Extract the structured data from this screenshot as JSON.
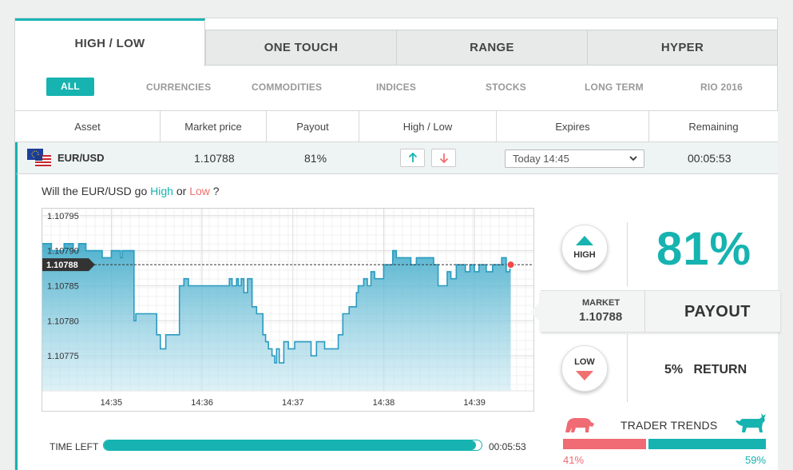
{
  "tabs": [
    {
      "label": "HIGH / LOW",
      "active": true
    },
    {
      "label": "ONE TOUCH",
      "active": false
    },
    {
      "label": "RANGE",
      "active": false
    },
    {
      "label": "HYPER",
      "active": false
    }
  ],
  "filters": [
    "ALL",
    "CURRENCIES",
    "COMMODITIES",
    "INDICES",
    "STOCKS",
    "LONG TERM",
    "RIO 2016"
  ],
  "columns": [
    "Asset",
    "Market price",
    "Payout",
    "High / Low",
    "Expires",
    "Remaining"
  ],
  "row": {
    "asset": "EUR/USD",
    "market_price": "1.10788",
    "payout": "81%",
    "expires": "Today 14:45",
    "remaining": "00:05:53"
  },
  "question": {
    "prefix": "Will the EUR/USD go ",
    "high": "High",
    "middle": " or ",
    "low": "Low",
    "suffix": " ?"
  },
  "chart_data": {
    "type": "area",
    "y_tick_labels": [
      "1.10795",
      "1.10790",
      "1.10785",
      "1.10780",
      "1.10775"
    ],
    "y_ticks": [
      1.10795,
      1.1079,
      1.10785,
      1.1078,
      1.10775
    ],
    "ylim": [
      1.1077,
      1.10796
    ],
    "x_tick_labels": [
      "14:35",
      "14:36",
      "14:37",
      "14:38",
      "14:39"
    ],
    "x_ticks_min": [
      0,
      1,
      2,
      3,
      4
    ],
    "xlim_min": [
      -0.76,
      4.65
    ],
    "current_value_label": "1.10788",
    "current_value": 1.10788,
    "grid": true,
    "series": [
      {
        "x_min": [
          -0.76,
          -0.66,
          -0.66,
          -0.52,
          -0.52,
          -0.42,
          -0.42,
          -0.36,
          -0.36,
          -0.28,
          -0.28,
          -0.18,
          -0.18,
          -0.1,
          -0.1,
          0.0,
          0.0,
          0.1,
          0.1,
          0.12,
          0.12,
          0.25,
          0.25,
          0.27,
          0.27,
          0.5,
          0.5,
          0.54,
          0.54,
          0.6,
          0.6,
          0.75,
          0.75,
          0.8,
          0.8,
          0.85,
          0.85,
          1.3,
          1.3,
          1.33,
          1.33,
          1.38,
          1.38,
          1.4,
          1.4,
          1.43,
          1.43,
          1.46,
          1.46,
          1.5,
          1.5,
          1.55,
          1.55,
          1.6,
          1.6,
          1.67,
          1.67,
          1.7,
          1.7,
          1.73,
          1.73,
          1.77,
          1.77,
          1.8,
          1.8,
          1.82,
          1.82,
          1.85,
          1.85,
          1.9,
          1.9,
          1.95,
          1.95,
          2.02,
          2.02,
          2.2,
          2.2,
          2.26,
          2.26,
          2.35,
          2.35,
          2.5,
          2.5,
          2.55,
          2.55,
          2.62,
          2.62,
          2.7,
          2.7,
          2.72,
          2.72,
          2.78,
          2.78,
          2.82,
          2.82,
          2.86,
          2.86,
          2.9,
          2.9,
          3.0,
          3.0,
          3.1,
          3.1,
          3.14,
          3.14,
          3.2,
          3.2,
          3.3,
          3.3,
          3.32,
          3.32,
          3.36,
          3.36,
          3.55,
          3.55,
          3.6,
          3.6,
          3.7,
          3.7,
          3.74,
          3.74,
          3.8,
          3.8,
          3.9,
          3.9,
          3.95,
          3.95,
          4.0,
          4.0,
          4.05,
          4.05,
          4.13,
          4.13,
          4.2,
          4.2,
          4.3,
          4.3,
          4.35,
          4.35,
          4.39,
          4.39,
          4.4
        ],
        "y": [
          1.10791,
          1.10791,
          1.1079,
          1.1079,
          1.10791,
          1.10791,
          1.1079,
          1.1079,
          1.10791,
          1.10791,
          1.1079,
          1.1079,
          1.1079,
          1.1079,
          1.10789,
          1.10789,
          1.1079,
          1.1079,
          1.10789,
          1.10789,
          1.1079,
          1.1079,
          1.1078,
          1.1078,
          1.10781,
          1.10781,
          1.10778,
          1.10778,
          1.10776,
          1.10776,
          1.10778,
          1.10778,
          1.10785,
          1.10785,
          1.10786,
          1.10786,
          1.10785,
          1.10785,
          1.10786,
          1.10786,
          1.10785,
          1.10785,
          1.10786,
          1.10786,
          1.10785,
          1.10785,
          1.10786,
          1.10786,
          1.10784,
          1.10784,
          1.10786,
          1.10786,
          1.10782,
          1.10782,
          1.10781,
          1.10781,
          1.10778,
          1.10778,
          1.10777,
          1.10777,
          1.10776,
          1.10776,
          1.10775,
          1.10775,
          1.10774,
          1.10774,
          1.10776,
          1.10776,
          1.10774,
          1.10774,
          1.10777,
          1.10777,
          1.10776,
          1.10776,
          1.10777,
          1.10777,
          1.10775,
          1.10775,
          1.10777,
          1.10777,
          1.10776,
          1.10776,
          1.10778,
          1.10778,
          1.10781,
          1.10781,
          1.10782,
          1.10782,
          1.10784,
          1.10784,
          1.10785,
          1.10785,
          1.10786,
          1.10786,
          1.10785,
          1.10785,
          1.10787,
          1.10787,
          1.10786,
          1.10786,
          1.10788,
          1.10788,
          1.1079,
          1.1079,
          1.10789,
          1.10789,
          1.10789,
          1.10789,
          1.10788,
          1.10788,
          1.10788,
          1.10788,
          1.10789,
          1.10789,
          1.10788,
          1.10788,
          1.10785,
          1.10785,
          1.10787,
          1.10787,
          1.10786,
          1.10786,
          1.10788,
          1.10788,
          1.10787,
          1.10787,
          1.10788,
          1.10788,
          1.10787,
          1.10787,
          1.10788,
          1.10788,
          1.10787,
          1.10787,
          1.10788,
          1.10788,
          1.10789,
          1.10789,
          1.10787,
          1.10787,
          1.10788,
          1.10788
        ]
      }
    ]
  },
  "trade": {
    "high_label": "HIGH",
    "low_label": "LOW",
    "payout_pct": "81%",
    "market_label": "MARKET",
    "market_value": "1.10788",
    "payout_label": "PAYOUT",
    "return_pct": "5%",
    "return_label": "RETURN"
  },
  "time_left": {
    "label": "TIME LEFT",
    "value": "00:05:53",
    "fraction": 0.985
  },
  "trader_trends": {
    "label": "TRADER TRENDS",
    "low_pct": "41%",
    "high_pct": "59%",
    "low_fraction": 0.41,
    "low_color": "#f06b73",
    "high_color": "#16b3b0"
  },
  "colors": {
    "accent": "#16b3b0",
    "low": "#f07070"
  }
}
